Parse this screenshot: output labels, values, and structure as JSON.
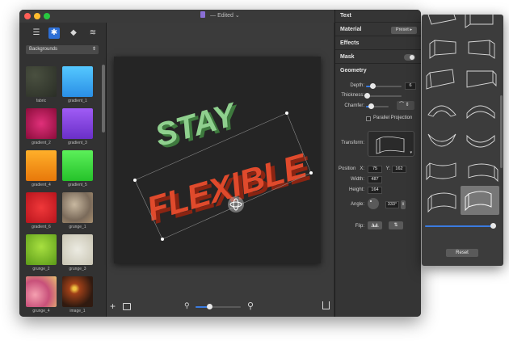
{
  "window": {
    "title": "— Edited",
    "doc_name": "",
    "traffic_lights": [
      "#ff5f57",
      "#febc2e",
      "#28c840"
    ]
  },
  "sidebar": {
    "tool_icons": [
      "list-icon",
      "gear-icon",
      "shapes-icon",
      "layers-icon"
    ],
    "category": "Backgrounds",
    "thumbnails": [
      {
        "label": "fabric",
        "color": "#34392f"
      },
      {
        "label": "gradient_1",
        "color": "#3fb4f0"
      },
      {
        "label": "gradient_2",
        "color": "#c2185b"
      },
      {
        "label": "gradient_3",
        "color": "#8a4fe0"
      },
      {
        "label": "gradient_4",
        "color": "#f39a1a"
      },
      {
        "label": "gradient_5",
        "color": "#3fdc45"
      },
      {
        "label": "gradient_6",
        "color": "#d8292e"
      },
      {
        "label": "grunge_1",
        "color": "#9a8a78"
      },
      {
        "label": "grunge_2",
        "color": "#7cc22a"
      },
      {
        "label": "grunge_3",
        "color": "#d8d4c6"
      },
      {
        "label": "grunge_4",
        "color": "#e07b8d"
      },
      {
        "label": "image_1",
        "color": "#4a2a18"
      }
    ]
  },
  "canvas": {
    "text_line1": "STAY",
    "text_line2": "FLEXIBLE",
    "line1_color": "#8fd08e",
    "line2_color": "#e04a2c"
  },
  "bottom_bar": {
    "add_icon": "+",
    "zoom_level": 0.3
  },
  "inspector": {
    "sections": {
      "text": "Text",
      "material": "Material",
      "material_button": "Preset ▸",
      "effects": "Effects",
      "mask": "Mask",
      "geometry": "Geometry"
    },
    "depth_label": "Depth:",
    "depth_value": "6",
    "thickness_label": "Thickness:",
    "chamfer_label": "Chamfer:",
    "parallel_label": "Parallel Projection",
    "transform_label": "Transform:",
    "position_label": "Position",
    "x_label": "X:",
    "x_value": "75",
    "y_label": "Y:",
    "y_value": "162",
    "width_label": "Width:",
    "width_value": "487",
    "height_label": "Height:",
    "height_value": "164",
    "angle_label": "Angle:",
    "angle_value": "333°",
    "flip_label": "Flip:"
  },
  "popover": {
    "reset_label": "Reset",
    "shapes": [
      "flat",
      "box-perspective",
      "box-left",
      "box-right",
      "arch-up",
      "arch-deep",
      "wave-left",
      "wave-right",
      "bulge",
      "ribbon",
      "curve-left",
      "curve-right-selected"
    ]
  }
}
